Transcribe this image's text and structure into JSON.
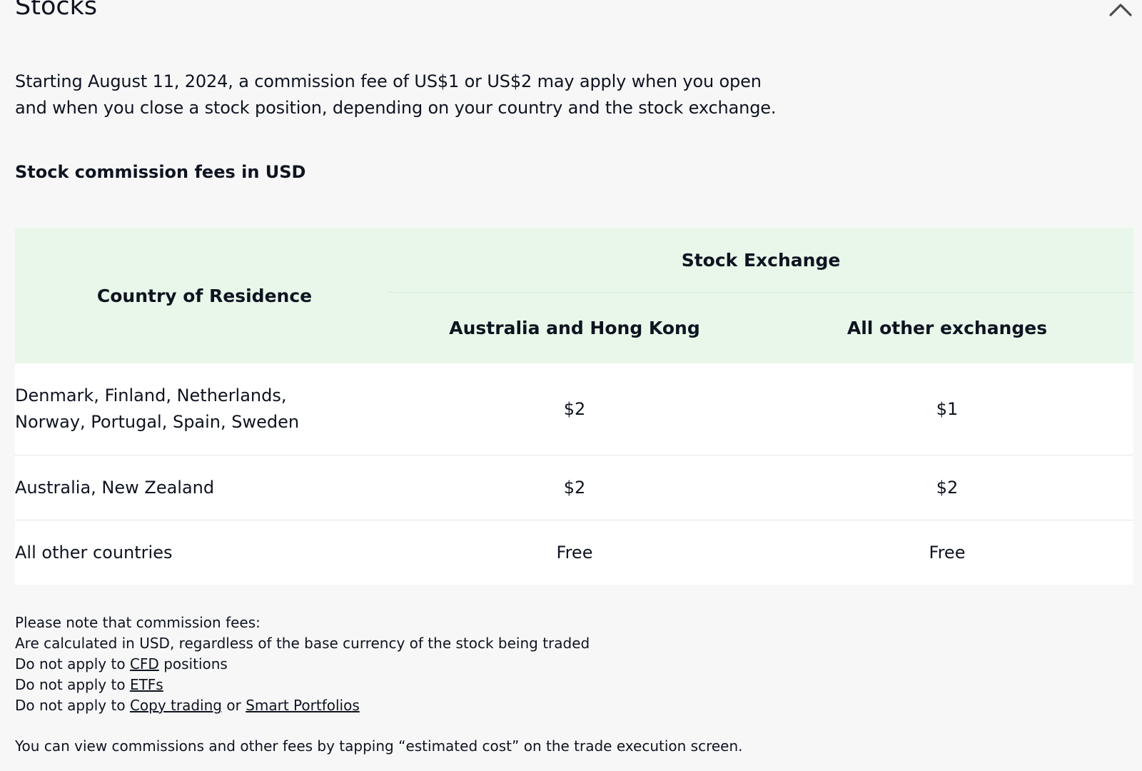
{
  "section": {
    "title": "Stocks"
  },
  "intro": {
    "line1": "Starting August 11, 2024, a commission fee of US$1 or US$2 may apply when you open",
    "line2": "and when you close a stock position, depending on your country and the stock exchange."
  },
  "subheading": "Stock commission fees in USD",
  "table": {
    "country_header": "Country of Residence",
    "exchange_header": "Stock Exchange",
    "exchange_columns": [
      "Australia and Hong Kong",
      "All other exchanges"
    ],
    "rows": [
      {
        "country_line1": "Denmark, Finland, Netherlands,",
        "country_line2": "Norway, Portugal, Spain, Sweden",
        "values": [
          "$2",
          "$1"
        ]
      },
      {
        "country_line1": "Australia, New Zealand",
        "country_line2": "",
        "values": [
          "$2",
          "$2"
        ]
      },
      {
        "country_line1": "All other countries",
        "country_line2": "",
        "values": [
          "Free",
          "Free"
        ]
      }
    ]
  },
  "notes": {
    "intro": "Please note that commission fees:",
    "item1": "Are calculated in USD, regardless of the base currency of the stock being traded",
    "item2_prefix": "Do not apply to",
    "item2_link": "CFD",
    "item2_suffix": "positions",
    "item3_prefix": "Do not apply to",
    "item3_link": "ETFs",
    "item4_prefix": "Do not apply to",
    "item4_link1": "Copy trading",
    "item4_mid": "or",
    "item4_link2": "Smart Portfolios"
  },
  "footer": "You can view commissions and other fees by tapping “estimated cost” on the trade execution screen.",
  "icons": {
    "collapse": "chevron-up-icon"
  }
}
